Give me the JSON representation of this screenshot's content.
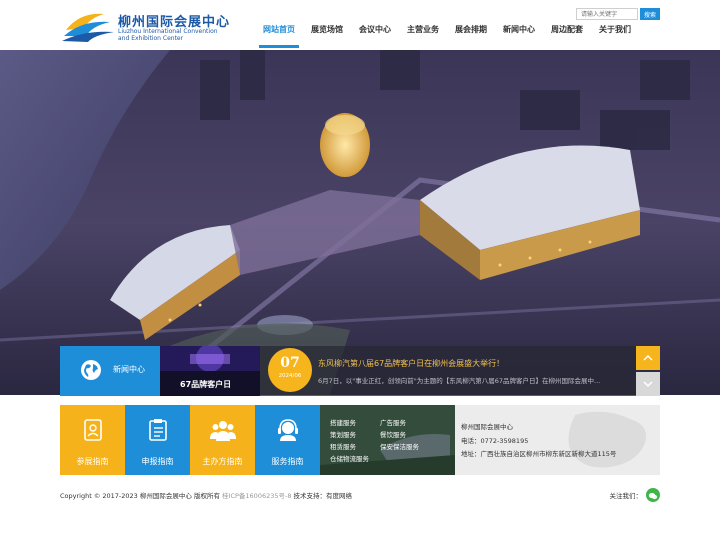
{
  "header": {
    "logo_cn": "柳州国际会展中心",
    "logo_en": "Liuzhou International Convention\nand Exhibition Center",
    "search_placeholder": "请输入关键字",
    "search_button": "搜索"
  },
  "nav": {
    "items": [
      {
        "label": "网站首页",
        "active": true
      },
      {
        "label": "展览场馆",
        "active": false
      },
      {
        "label": "会议中心",
        "active": false
      },
      {
        "label": "主营业务",
        "active": false
      },
      {
        "label": "展会排期",
        "active": false
      },
      {
        "label": "新闻中心",
        "active": false
      },
      {
        "label": "周边配套",
        "active": false
      },
      {
        "label": "关于我们",
        "active": false
      }
    ]
  },
  "news": {
    "tab_label": "新闻中心",
    "thumb_caption": "67品牌客户日",
    "day": "07",
    "year_month": "2024/06",
    "title": "东风柳汽第八届67品牌客户日在柳州会展盛大举行！",
    "desc": "6月7日，以\"事业正红，创领向前\"为主题的【东风柳汽第八届67品牌客户日】在柳州国际会展中..."
  },
  "guides": {
    "tiles": [
      {
        "label": "参展指南",
        "icon": "exhibitor-badge-icon"
      },
      {
        "label": "申报指南",
        "icon": "clipboard-list-icon"
      },
      {
        "label": "主办方指南",
        "icon": "group-people-icon"
      },
      {
        "label": "服务指南",
        "icon": "customer-service-headset-icon"
      }
    ]
  },
  "services": {
    "items": [
      "搭建服务",
      "广告服务",
      "策划服务",
      "餐饮服务",
      "租赁服务",
      "保安保洁服务",
      "仓储物流服务"
    ]
  },
  "contact": {
    "name": "柳州国际会展中心",
    "phone": "电话：0772-3598195",
    "address": "地址：广西壮族自治区柳州市柳东新区新柳大道115号"
  },
  "footer": {
    "copyright": "Copyright © 2017-2023 柳州国际会展中心 版权所有 ",
    "icp": "桂ICP备16006235号-8",
    "support": " 技术支持：有度网络",
    "follow": "关注我们："
  },
  "colors": {
    "brand_blue": "#1f8ed9",
    "accent_yellow": "#f5b21a",
    "wechat_green": "#3fb549"
  }
}
